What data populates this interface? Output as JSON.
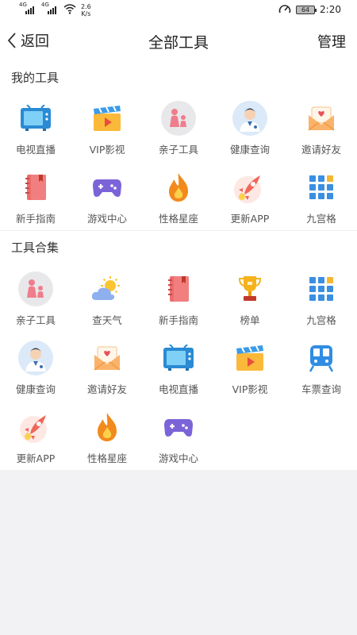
{
  "status_bar": {
    "sim1": "4G",
    "sim2": "4G",
    "speed_value": "2.6",
    "speed_unit": "K/s",
    "battery": "64",
    "time": "2:20"
  },
  "nav": {
    "back_label": "返回",
    "title": "全部工具",
    "manage_label": "管理"
  },
  "my_tools": {
    "title": "我的工具",
    "items": [
      {
        "label": "电视直播",
        "icon": "tv-icon"
      },
      {
        "label": "VIP影视",
        "icon": "video-clapper-icon"
      },
      {
        "label": "亲子工具",
        "icon": "parent-child-icon"
      },
      {
        "label": "健康查询",
        "icon": "doctor-icon"
      },
      {
        "label": "邀请好友",
        "icon": "invite-envelope-icon"
      },
      {
        "label": "新手指南",
        "icon": "guide-book-icon"
      },
      {
        "label": "游戏中心",
        "icon": "gamepad-icon"
      },
      {
        "label": "性格星座",
        "icon": "fire-icon"
      },
      {
        "label": "更新APP",
        "icon": "rocket-icon"
      },
      {
        "label": "九宫格",
        "icon": "nine-grid-icon"
      }
    ]
  },
  "tool_collection": {
    "title": "工具合集",
    "items": [
      {
        "label": "亲子工具",
        "icon": "parent-child-icon"
      },
      {
        "label": "查天气",
        "icon": "weather-icon"
      },
      {
        "label": "新手指南",
        "icon": "guide-book-icon"
      },
      {
        "label": "榜单",
        "icon": "trophy-icon"
      },
      {
        "label": "九宫格",
        "icon": "nine-grid-icon"
      },
      {
        "label": "健康查询",
        "icon": "doctor-icon"
      },
      {
        "label": "邀请好友",
        "icon": "invite-envelope-icon"
      },
      {
        "label": "电视直播",
        "icon": "tv-icon"
      },
      {
        "label": "VIP影视",
        "icon": "video-clapper-icon"
      },
      {
        "label": "车票查询",
        "icon": "train-ticket-icon"
      },
      {
        "label": "更新APP",
        "icon": "rocket-icon"
      },
      {
        "label": "性格星座",
        "icon": "fire-icon"
      },
      {
        "label": "游戏中心",
        "icon": "gamepad-icon"
      }
    ]
  }
}
